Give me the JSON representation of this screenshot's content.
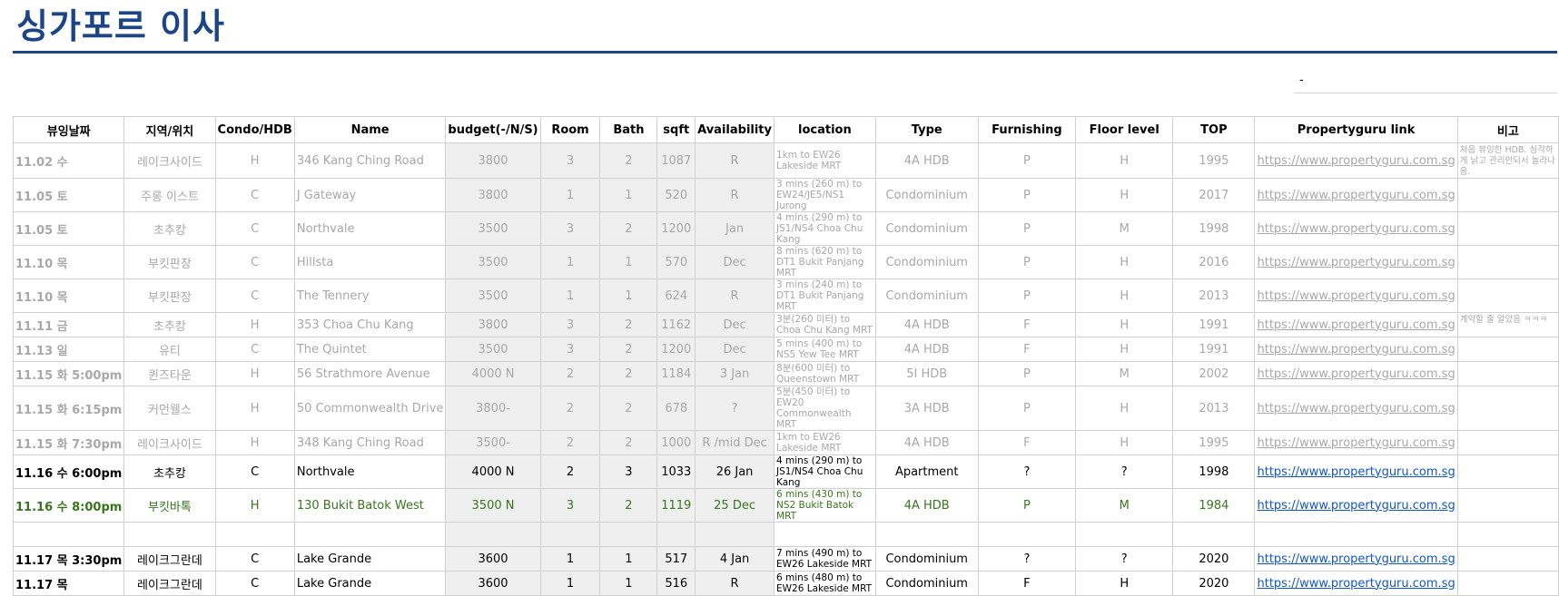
{
  "title": "싱가포르 이사",
  "note": "-",
  "headers": [
    "뷰잉날짜",
    "지역/위치",
    "Condo/HDB",
    "Name",
    "budget(-/N/S)",
    "Room",
    "Bath",
    "sqft",
    "Availability",
    "location",
    "Type",
    "Furnishing",
    "Floor level",
    "TOP",
    "Propertyguru link",
    "비고"
  ],
  "rows": [
    {
      "style": "gray",
      "date": "11.02 수",
      "area": "레이크사이드",
      "kind": "H",
      "name": "346 Kang Ching Road",
      "budget": "3800",
      "room": "3",
      "bath": "2",
      "sqft": "1087",
      "avail": "R",
      "loc": "1km to EW26 Lakeside MRT",
      "type": "4A HDB",
      "furn": "P",
      "floor": "H",
      "top": "1995",
      "link": "https://www.propertyguru.com.sg",
      "memo": "처음 뷰잉한 HDB. 심각하게 낡고 관리안되서 놀라나옴."
    },
    {
      "style": "gray",
      "date": "11.05 토",
      "area": "주롱 이스트",
      "kind": "C",
      "name": "J Gateway",
      "budget": "3800",
      "room": "1",
      "bath": "1",
      "sqft": "520",
      "avail": "R",
      "loc": "3 mins (260 m) to EW24/JE5/NS1 Jurong",
      "type": "Condominium",
      "furn": "P",
      "floor": "H",
      "top": "2017",
      "link": "https://www.propertyguru.com.sg",
      "memo": ""
    },
    {
      "style": "gray",
      "date": "11.05 토",
      "area": "초추캉",
      "kind": "C",
      "name": "Northvale",
      "budget": "3500",
      "room": "3",
      "bath": "2",
      "sqft": "1200",
      "avail": "Jan",
      "loc": "4 mins (290 m) to JS1/NS4 Choa Chu Kang",
      "type": "Condominium",
      "furn": "P",
      "floor": "M",
      "top": "1998",
      "link": "https://www.propertyguru.com.sg",
      "memo": ""
    },
    {
      "style": "gray",
      "date": "11.10 목",
      "area": "부킷판장",
      "kind": "C",
      "name": "Hillsta",
      "budget": "3500",
      "room": "1",
      "bath": "1",
      "sqft": "570",
      "avail": "Dec",
      "loc": "8 mins (620 m) to DT1 Bukit Panjang MRT",
      "type": "Condominium",
      "furn": "P",
      "floor": "H",
      "top": "2016",
      "link": "https://www.propertyguru.com.sg",
      "memo": ""
    },
    {
      "style": "gray",
      "date": "11.10 목",
      "area": "부킷판장",
      "kind": "C",
      "name": "The Tennery",
      "budget": "3500",
      "room": "1",
      "bath": "1",
      "sqft": "624",
      "avail": "R",
      "loc": "3 mins (240 m) to DT1 Bukit Panjang MRT",
      "type": "Condominium",
      "furn": "P",
      "floor": "H",
      "top": "2013",
      "link": "https://www.propertyguru.com.sg",
      "memo": ""
    },
    {
      "style": "gray",
      "date": "11.11 금",
      "area": "초추캉",
      "kind": "H",
      "name": "353 Choa Chu Kang",
      "budget": "3800",
      "room": "3",
      "bath": "2",
      "sqft": "1162",
      "avail": "Dec",
      "loc": "3분(260 미터) to Choa Chu Kang MRT",
      "type": "4A HDB",
      "furn": "F",
      "floor": "H",
      "top": "1991",
      "link": "https://www.propertyguru.com.sg",
      "memo": "계약할 줄 알았음 ㅋㅋㅋ"
    },
    {
      "style": "gray",
      "date": "11.13 일",
      "area": "유티",
      "kind": "C",
      "name": "The Quintet",
      "budget": "3500",
      "room": "3",
      "bath": "2",
      "sqft": "1200",
      "avail": "Dec",
      "loc": "5 mins (400 m) to NS5 Yew Tee MRT",
      "type": "4A HDB",
      "furn": "F",
      "floor": "H",
      "top": "1991",
      "link": "https://www.propertyguru.com.sg",
      "memo": ""
    },
    {
      "style": "gray",
      "date": "11.15 화 5:00pm",
      "area": "퀸즈타운",
      "kind": "H",
      "name": "56 Strathmore Avenue",
      "budget": "4000 N",
      "room": "2",
      "bath": "2",
      "sqft": "1184",
      "avail": "3 Jan",
      "loc": "8분(600 미터) to Queenstown MRT",
      "type": "5I HDB",
      "furn": "P",
      "floor": "M",
      "top": "2002",
      "link": "https://www.propertyguru.com.sg",
      "memo": ""
    },
    {
      "style": "gray",
      "date": "11.15 화 6:15pm",
      "area": "커먼웰스",
      "kind": "H",
      "name": "50 Commonwealth Drive",
      "budget": "3800-",
      "room": "2",
      "bath": "2",
      "sqft": "678",
      "avail": "?",
      "loc": "5분(450 미터) to EW20 Commonwealth MRT",
      "type": "3A HDB",
      "furn": "P",
      "floor": "H",
      "top": "2013",
      "link": "https://www.propertyguru.com.sg",
      "memo": ""
    },
    {
      "style": "gray",
      "date": "11.15 화 7:30pm",
      "area": "레이크사이드",
      "kind": "H",
      "name": "348 Kang Ching Road",
      "budget": "3500-",
      "room": "2",
      "bath": "2",
      "sqft": "1000",
      "avail": "R /mid Dec",
      "loc": "1km to EW26 Lakeside MRT",
      "type": "4A HDB",
      "furn": "F",
      "floor": "H",
      "top": "1995",
      "link": "https://www.propertyguru.com.sg",
      "memo": ""
    },
    {
      "style": "active",
      "date": "11.16 수 6:00pm",
      "area": "초추캉",
      "kind": "C",
      "name": "Northvale",
      "budget": "4000 N",
      "room": "2",
      "bath": "3",
      "sqft": "1033",
      "avail": "26 Jan",
      "loc": "4 mins (290 m) to JS1/NS4 Choa Chu Kang",
      "type": "Apartment",
      "furn": "?",
      "floor": "?",
      "top": "1998",
      "link": "https://www.propertyguru.com.sg",
      "memo": ""
    },
    {
      "style": "green",
      "date": "11.16 수 8:00pm",
      "area": "부킷바톡",
      "kind": "H",
      "name": "130 Bukit Batok West",
      "budget": "3500 N",
      "room": "3",
      "bath": "2",
      "sqft": "1119",
      "avail": "25 Dec",
      "loc": "6 mins (430 m) to NS2 Bukit Batok MRT",
      "type": "4A HDB",
      "furn": "P",
      "floor": "M",
      "top": "1984",
      "link": "https://www.propertyguru.com.sg",
      "memo": ""
    },
    {
      "style": "active",
      "date": "",
      "area": "",
      "kind": "",
      "name": "",
      "budget": "",
      "room": "",
      "bath": "",
      "sqft": "",
      "avail": "",
      "loc": "",
      "type": "",
      "furn": "",
      "floor": "",
      "top": "",
      "link": "",
      "memo": ""
    },
    {
      "style": "active",
      "date": "11.17 목 3:30pm",
      "area": "레이크그란데",
      "kind": "C",
      "name": "Lake Grande",
      "budget": "3600",
      "room": "1",
      "bath": "1",
      "sqft": "517",
      "avail": "4 Jan",
      "loc": "7 mins (490 m) to EW26 Lakeside MRT",
      "type": "Condominium",
      "furn": "?",
      "floor": "?",
      "top": "2020",
      "link": "https://www.propertyguru.com.sg",
      "memo": ""
    },
    {
      "style": "active",
      "date": "11.17 목",
      "area": "레이크그란데",
      "kind": "C",
      "name": "Lake Grande",
      "budget": "3600",
      "room": "1",
      "bath": "1",
      "sqft": "516",
      "avail": "R",
      "loc": "6 mins (480 m) to EW26 Lakeside MRT",
      "type": "Condominium",
      "furn": "F",
      "floor": "H",
      "top": "2020",
      "link": "https://www.propertyguru.com.sg",
      "memo": ""
    }
  ]
}
